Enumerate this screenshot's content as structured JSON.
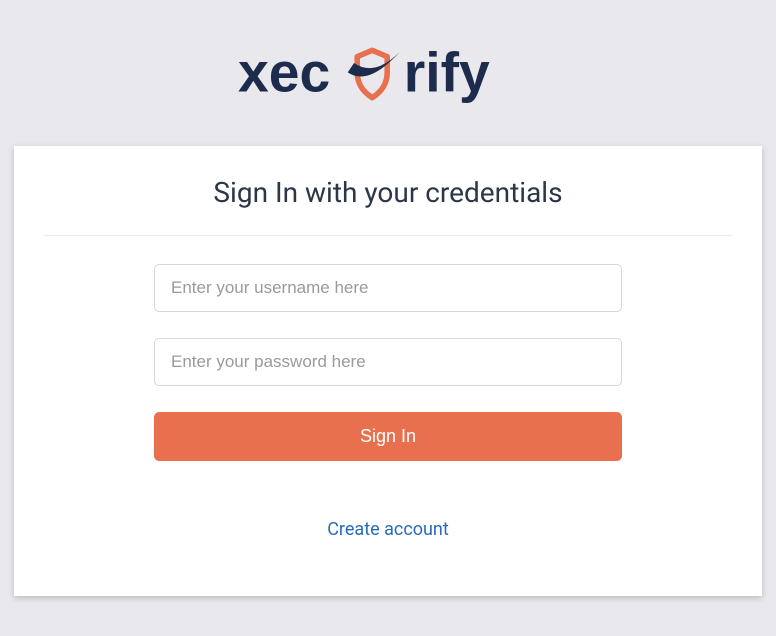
{
  "brand": {
    "name": "xecurify"
  },
  "form": {
    "title": "Sign In with your credentials",
    "username_placeholder": "Enter your username here",
    "password_placeholder": "Enter your password here",
    "submit_label": "Sign In",
    "create_account_label": "Create account"
  },
  "colors": {
    "accent": "#e8704e",
    "navy": "#1d2c4d",
    "link": "#2a6bb8",
    "background": "#e9e9ed"
  }
}
